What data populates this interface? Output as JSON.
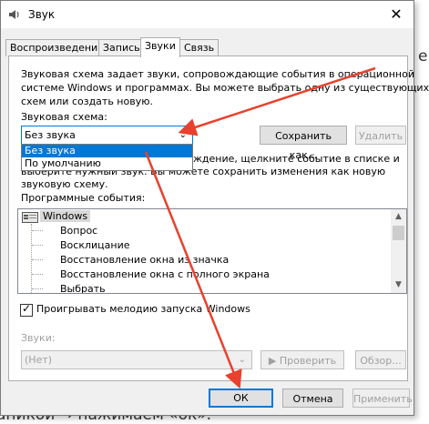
{
  "background": {
    "top_text": "....................",
    "right_glyph": "е",
    "bottom_text": "аникой → нажимаем «ок»."
  },
  "window": {
    "title": "Звук",
    "close_glyph": "✕"
  },
  "tabs": [
    {
      "label": "Воспроизведение",
      "active": false
    },
    {
      "label": "Запись",
      "active": false
    },
    {
      "label": "Звуки",
      "active": true
    },
    {
      "label": "Связь",
      "active": false
    }
  ],
  "description_lines": [
    "Звуковая схема задает звуки, сопровождающие события в операционной",
    "системе Windows и программах. Вы можете выбрать одну из существующих",
    "схем или создать новую."
  ],
  "scheme": {
    "label": "Звуковая схема:",
    "value": "Без звука",
    "options": [
      "Без звука",
      "По умолчанию"
    ],
    "save_label": "Сохранить как...",
    "delete_label": "Удалить"
  },
  "change_text_lines": [
    "ждение, щелкните событие в списке и",
    "выберите нужный звук. Вы можете сохранить изменения как новую",
    "звуковую схему."
  ],
  "events": {
    "label": "Программные события:",
    "root": "Windows",
    "items": [
      "Вопрос",
      "Восклицание",
      "Восстановление окна из значка",
      "Восстановление окна с полного экрана",
      "Выбрать"
    ]
  },
  "startup_checkbox": {
    "label": "Проигрывать мелодию запуска Windows",
    "checked": true
  },
  "sounds": {
    "label": "Звуки:",
    "value": "(Нет)",
    "test_label": "Проверить",
    "browse_label": "Обзор..."
  },
  "footer": {
    "ok": "ОК",
    "cancel": "Отмена",
    "apply": "Применить"
  },
  "colors": {
    "accent": "#0078d7",
    "annotation_arrow": "#e8412e",
    "disabled_text": "#a0a0a0"
  },
  "icons": [
    "speaker-icon",
    "windows-folder-icon",
    "play-icon",
    "chevron-down-icon",
    "close-icon",
    "check-icon"
  ]
}
